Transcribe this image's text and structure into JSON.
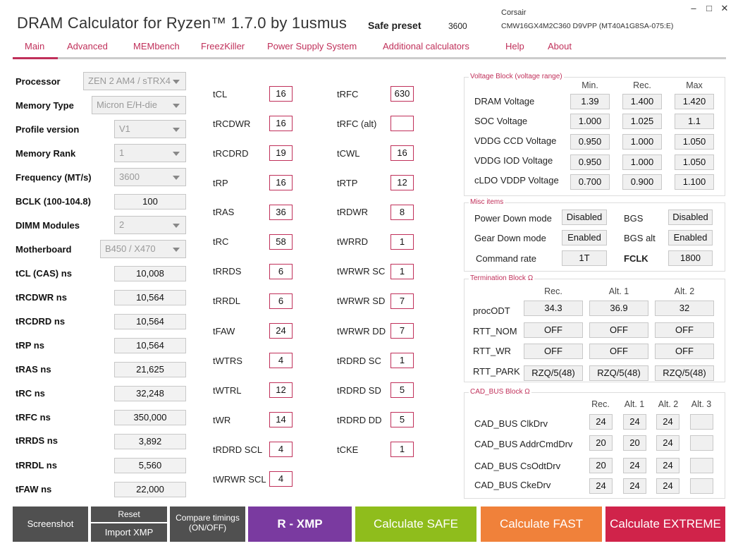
{
  "header": {
    "title": "DRAM Calculator for Ryzen™ 1.7.0 by 1usmus",
    "preset_label": "Safe preset",
    "preset_value": "3600",
    "brand": "Corsair",
    "module": "CMW16GX4M2C360 D9VPP (MT40A1G8SA-075:E)",
    "window_controls": {
      "minimize": "–",
      "maximize": "□",
      "close": "✕"
    }
  },
  "menu": [
    {
      "label": "Main",
      "active": true
    },
    {
      "label": "Advanced"
    },
    {
      "label": "MEMbench"
    },
    {
      "label": "FreezKiller"
    },
    {
      "label": "Power Supply System"
    },
    {
      "label": "Additional calculators"
    },
    {
      "label": "Help"
    },
    {
      "label": "About"
    }
  ],
  "left_panel": {
    "processor": {
      "label": "Processor",
      "value": "ZEN 2 AM4 / sTRX4"
    },
    "memory_type": {
      "label": "Memory Type",
      "value": "Micron E/H-die"
    },
    "profile_version": {
      "label": "Profile version",
      "value": "V1"
    },
    "memory_rank": {
      "label": "Memory Rank",
      "value": "1"
    },
    "frequency": {
      "label": "Frequency (MT/s)",
      "value": "3600"
    },
    "bclk": {
      "label": "BCLK (100-104.8)",
      "value": "100"
    },
    "dimm_modules": {
      "label": "DIMM Modules",
      "value": "2"
    },
    "motherboard": {
      "label": "Motherboard",
      "value": "B450 / X470"
    },
    "ns_rows": [
      {
        "label": "tCL (CAS) ns",
        "value": "10,008"
      },
      {
        "label": "tRCDWR ns",
        "value": "10,564"
      },
      {
        "label": "tRCDRD ns",
        "value": "10,564"
      },
      {
        "label": "tRP ns",
        "value": "10,564"
      },
      {
        "label": "tRAS ns",
        "value": "21,625"
      },
      {
        "label": "tRC ns",
        "value": "32,248"
      },
      {
        "label": "tRFC ns",
        "value": "350,000"
      },
      {
        "label": "tRRDS ns",
        "value": "3,892"
      },
      {
        "label": "tRRDL ns",
        "value": "5,560"
      },
      {
        "label": "tFAW ns",
        "value": "22,000"
      }
    ]
  },
  "timings_col1": [
    {
      "label": "tCL",
      "value": "16"
    },
    {
      "label": "tRCDWR",
      "value": "16"
    },
    {
      "label": "tRCDRD",
      "value": "19"
    },
    {
      "label": "tRP",
      "value": "16"
    },
    {
      "label": "tRAS",
      "value": "36"
    },
    {
      "label": "tRC",
      "value": "58"
    },
    {
      "label": "tRRDS",
      "value": "6"
    },
    {
      "label": "tRRDL",
      "value": "6"
    },
    {
      "label": "tFAW",
      "value": "24"
    },
    {
      "label": "tWTRS",
      "value": "4"
    },
    {
      "label": "tWTRL",
      "value": "12"
    },
    {
      "label": "tWR",
      "value": "14"
    },
    {
      "label": "tRDRD SCL",
      "value": "4"
    },
    {
      "label": "tWRWR SCL",
      "value": "4"
    }
  ],
  "timings_col2": [
    {
      "label": "tRFC",
      "value": "630"
    },
    {
      "label": "tRFC (alt)",
      "value": ""
    },
    {
      "label": "tCWL",
      "value": "16"
    },
    {
      "label": "tRTP",
      "value": "12"
    },
    {
      "label": "tRDWR",
      "value": "8"
    },
    {
      "label": "tWRRD",
      "value": "1"
    },
    {
      "label": "tWRWR SC",
      "value": "1"
    },
    {
      "label": "tWRWR SD",
      "value": "7"
    },
    {
      "label": "tWRWR DD",
      "value": "7"
    },
    {
      "label": "tRDRD SC",
      "value": "1"
    },
    {
      "label": "tRDRD SD",
      "value": "5"
    },
    {
      "label": "tRDRD DD",
      "value": "5"
    },
    {
      "label": "tCKE",
      "value": "1"
    }
  ],
  "voltage_block": {
    "title": "Voltage Block (voltage range)",
    "headers": [
      "Min.",
      "Rec.",
      "Max"
    ],
    "rows": [
      {
        "label": "DRAM Voltage",
        "values": [
          "1.39",
          "1.400",
          "1.420"
        ]
      },
      {
        "label": "SOC Voltage",
        "values": [
          "1.000",
          "1.025",
          "1.1"
        ]
      },
      {
        "label": "VDDG  CCD Voltage",
        "values": [
          "0.950",
          "1.000",
          "1.050"
        ]
      },
      {
        "label": "VDDG  IOD Voltage",
        "values": [
          "0.950",
          "1.000",
          "1.050"
        ]
      },
      {
        "label": "cLDO VDDP Voltage",
        "values": [
          "0.700",
          "0.900",
          "1.100"
        ]
      }
    ]
  },
  "misc_block": {
    "title": "Misc items",
    "power_down": {
      "label": "Power Down mode",
      "value": "Disabled"
    },
    "bgs": {
      "label": "BGS",
      "value": "Disabled"
    },
    "gear_down": {
      "label": "Gear Down mode",
      "value": "Enabled"
    },
    "bgs_alt": {
      "label": "BGS alt",
      "value": "Enabled"
    },
    "command_rate": {
      "label": "Command rate",
      "value": "1T"
    },
    "fclk": {
      "label": "FCLK",
      "value": "1800"
    }
  },
  "termination_block": {
    "title": "Termination Block Ω",
    "headers": [
      "Rec.",
      "Alt. 1",
      "Alt. 2"
    ],
    "rows": [
      {
        "label": "procODT",
        "values": [
          "34.3",
          "36.9",
          "32"
        ]
      },
      {
        "label": "RTT_NOM",
        "values": [
          "OFF",
          "OFF",
          "OFF"
        ]
      },
      {
        "label": "RTT_WR",
        "values": [
          "OFF",
          "OFF",
          "OFF"
        ]
      },
      {
        "label": "RTT_PARK",
        "values": [
          "RZQ/5(48)",
          "RZQ/5(48)",
          "RZQ/5(48)"
        ]
      }
    ]
  },
  "cadbus_block": {
    "title": "CAD_BUS Block Ω",
    "headers": [
      "Rec.",
      "Alt. 1",
      "Alt. 2",
      "Alt. 3"
    ],
    "rows": [
      {
        "label": "CAD_BUS ClkDrv",
        "values": [
          "24",
          "24",
          "24",
          ""
        ]
      },
      {
        "label": "CAD_BUS AddrCmdDrv",
        "values": [
          "20",
          "20",
          "24",
          ""
        ]
      },
      {
        "label": "CAD_BUS CsOdtDrv",
        "values": [
          "20",
          "24",
          "24",
          ""
        ]
      },
      {
        "label": "CAD_BUS CkeDrv",
        "values": [
          "24",
          "24",
          "24",
          ""
        ]
      }
    ]
  },
  "bottom_bar": {
    "screenshot": "Screenshot",
    "reset": "Reset",
    "import_xmp": "Import XMP",
    "compare_line1": "Compare timings",
    "compare_line2": "(ON/OFF)",
    "rxmp": "R - XMP",
    "calc_safe": "Calculate SAFE",
    "calc_fast": "Calculate FAST",
    "calc_extreme": "Calculate EXTREME",
    "colors": {
      "gray": "#505050",
      "purple": "#7a3aa0",
      "green": "#8fbd1c",
      "orange": "#f0813a",
      "red": "#d0234a"
    }
  }
}
